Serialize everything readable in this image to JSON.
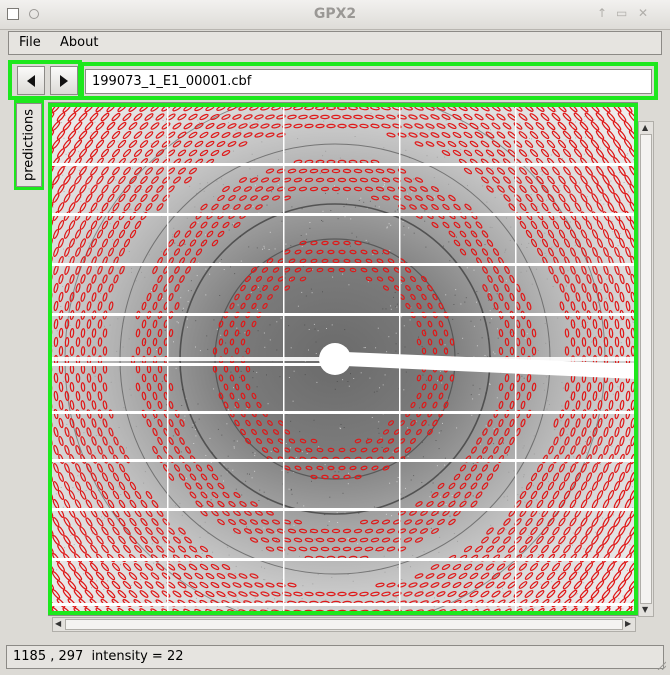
{
  "window": {
    "title": "GPX2"
  },
  "titlebar_buttons": [
    "↑",
    "▭",
    "✕"
  ],
  "menu": {
    "items": [
      "File",
      "About"
    ]
  },
  "nav": {
    "prev_icon": "left-arrow-icon",
    "next_icon": "right-arrow-icon"
  },
  "file": {
    "name": "199073_1_E1_00001.cbf"
  },
  "sidebar": {
    "tab_label": "predictions"
  },
  "status": {
    "coords": "1185 , 297",
    "intensity_label": "intensity = 22"
  },
  "colors": {
    "highlight": "#1de81d",
    "prediction": "#e01818"
  }
}
